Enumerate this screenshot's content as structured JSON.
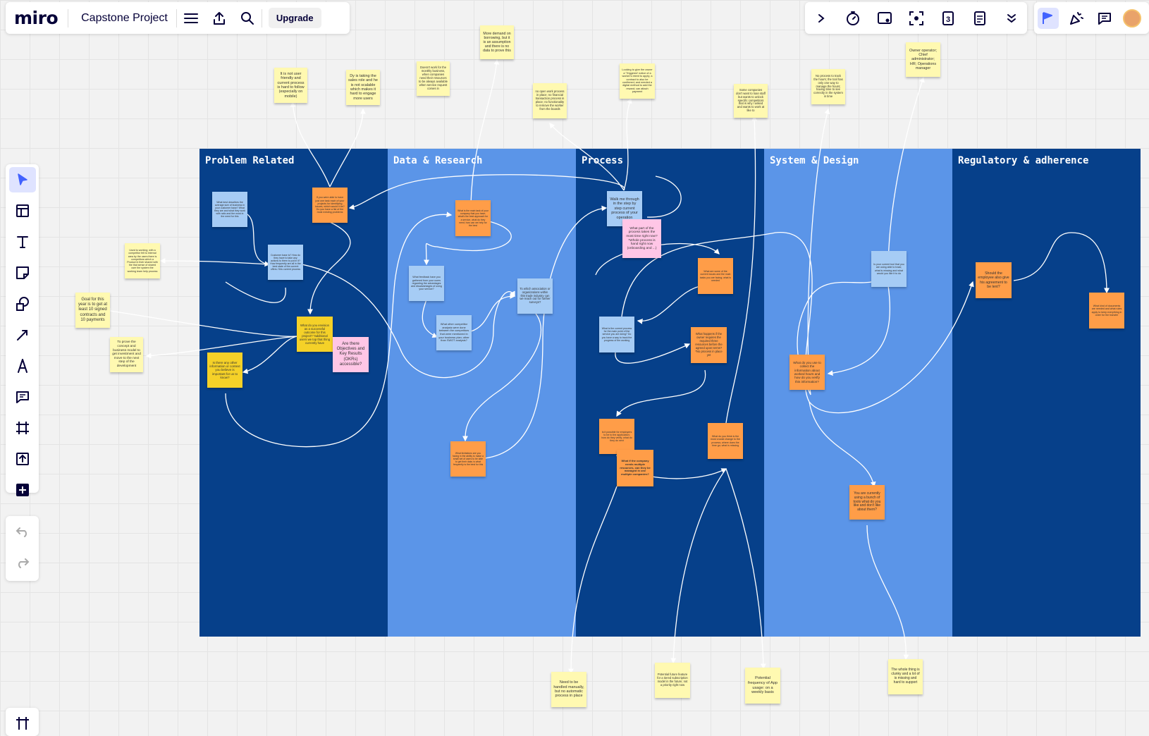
{
  "app": {
    "logo": "miro",
    "board_title": "Capstone Project",
    "upgrade_label": "Upgrade"
  },
  "toolbar_right": {
    "notes_count": "3"
  },
  "columns": [
    {
      "title": "Problem Related"
    },
    {
      "title": "Data & Research"
    },
    {
      "title": "Process"
    },
    {
      "title": "System & Design"
    },
    {
      "title": "Regulatory & adherence"
    }
  ],
  "notes": {
    "top_1": "It is not user friendly and current process is hard to follow (especially on mobile)",
    "top_2": "Dy is taking the sales role and he is not scalable which makes it hard to engage more users",
    "top_3": "Doesn't work for the monthly business, when companies need their resources to be always available when service request comes in",
    "top_4": "More demand on borrowing, but it is an assumption and there is no data to prove this",
    "top_5": "no open work process in place; no financial transaction process in place; no functionality to remove the worker from the boards",
    "top_6": "Looking to give the owner a 'Triggered' notice of a worker's intent to apply; a contract to also be confirmed; and needed a digital method to add the reward; can attach payment",
    "top_7": "Some companies don't want to loan staff but wants to unlock specific competitors that is why I asked and wants to work at like to",
    "top_8": "No process to track the hours; the tool has only one way to manage the hours; having time to see correctly in the system in time",
    "top_9": "Owner operator; Chief administrator; HR; Operations manager",
    "left_1": "Used to working; with a competitor felt to internal area by the users there is competitors which a Product in their shared with the that sense of shared user the system the working team help process",
    "left_2": "Goal for this year is to get at least 10 signed contracts and 10 payments",
    "left_3": "To prove the concept and business model to get investment and move to the next step of the development",
    "pr_1": "What best describes the average size of business in your customer base? What they are and what they work with ratio and the most in the need for this",
    "pr_2": "If you were able to have just one task each of your projects for identifying issues, which would it be? Do you have a list of the most existing problems",
    "pr_3": "Customer base is? How do they have to take any actions to them to put in it? How frequently are all in the best state of the current offers / this current process",
    "pr_4": "What do you envision as a successful outcome for this project? *additional users we top that thing currently have",
    "pr_5": "Are there Objectives and Key Results (OKRs) accessible?",
    "pr_6": "Is there any other information or context you believe is important for us to know?",
    "dr_1": "What is the main task of your company that you have; what's the best approach for a service, what do they need; how can we help for the best",
    "dr_2": "What feedback have you gathered from your users regarding the advantages and disadvantages of using your service?",
    "dr_3": "To which association or organizations within this trade industry can we reach out for further surveys?",
    "dr_4": "What other competitor analysis were done between the competitors that were mentioned in your business plan; other than SWOT analysis?",
    "dr_5": "What limitations are you facing in the ability to make a small set of users to be able to get their data; is what frequently is the best for this",
    "pc_1": "Walk me through in the step by step current process of your operation",
    "pc_2": "What part of the process takes the most time right now? *Whole process is hand right now (onboarding and ...)",
    "pc_3": "What is the current process for the main point of the service you are doing? Do you have a way to track the progress of the working",
    "pc_4": "What happens if the owner requires the required three resources before the agreed upon terms? *No process in place yet",
    "pc_5": "What are some of the current issues and the main tasks you are facing; what is needed",
    "pc_6": "Is it possible for employers to be to the application; how do they verify; what do they do next",
    "pc_7": "What if the company needs multiple resources, can they be managed in one multiple companies?",
    "pc_8": "What do you think is the most crucial change to the process; where does the time go; what is missing",
    "sd_1": "Is your current tool that you are using able to track; what is missing and what would you like it to do",
    "sd_2": "What do you use to collect the information about worked hours and how do you verify this information?",
    "sd_3": "You are currently using a bunch of tools what do you like and don't like about them?",
    "ra_1": "Should the employee also give his agreement to be lent?",
    "ra_2": "What kind of documents are needed and what rules apply to keep everything in order for the transfer",
    "bottom_1": "Need to be handled manually, but no automatic process in place",
    "bottom_2": "Potential future feature for a tiered subscription model in the future; not a priority right now",
    "bottom_3": "Potential frequency of App usage: on a weekly basis",
    "bottom_4": "The whole thing is clunky and a lot of is missing and hard to support"
  },
  "colors": {
    "dark_frame": "#06408a",
    "light_frame": "#5b95e8",
    "yellow": "#fff9b1",
    "orange": "#ff9d48",
    "blue": "#a6ccf5",
    "pink": "#ffc6e6",
    "accent": "#4262ff"
  }
}
